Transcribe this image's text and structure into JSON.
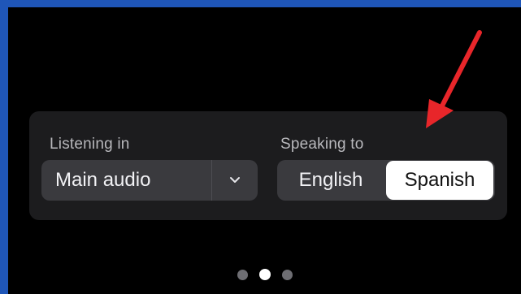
{
  "listening": {
    "label": "Listening in",
    "selected": "Main audio",
    "icon": "chevron-down-icon"
  },
  "speaking": {
    "label": "Speaking to",
    "options": [
      "English",
      "Spanish"
    ],
    "selected": "Spanish"
  },
  "pagination": {
    "pages": 3,
    "current": 2
  },
  "colors": {
    "frame": "#1f56b8",
    "background": "#000000",
    "panel": "#1c1c1e",
    "control": "#3a3a3e",
    "selected_segment": "#ffffff",
    "annotation_arrow": "#e8262a"
  }
}
